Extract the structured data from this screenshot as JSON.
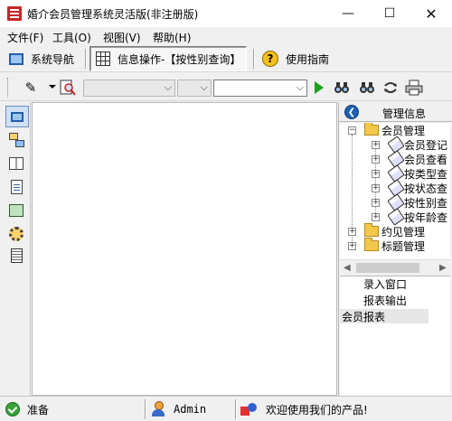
{
  "window": {
    "title": "婚介会员管理系统灵活版(非注册版)",
    "minimize_glyph": "—",
    "maximize_glyph": "☐",
    "close_glyph": "✕"
  },
  "menu": {
    "file": "文件(F)",
    "tools": "工具(O)",
    "view": "视图(V)",
    "help": "帮助(H)"
  },
  "nav": {
    "system_nav": "系统导航",
    "info_ops": "信息操作-【按性别查询】",
    "user_guide": "使用指南"
  },
  "toolbar": {
    "pencil_icon": "✎",
    "search_icons": [
      "binoculars-icon",
      "binoculars-icon",
      "refresh-icon",
      "printer-icon"
    ]
  },
  "right_panel": {
    "header_title": "管理信息",
    "collapse_glyph": "❮",
    "tree": {
      "member_mgmt": "会员管理",
      "children": [
        "会员登记",
        "会员查看",
        "按类型查",
        "按状态查",
        "按性别查",
        "按年龄查"
      ],
      "date_mgmt": "约见管理",
      "title_mgmt": "标题管理"
    },
    "windows": {
      "entry_window": "录入窗口",
      "report_output": "报表输出",
      "member_report": "会员报表"
    }
  },
  "status": {
    "ready": "准备",
    "user": "Admin",
    "welcome": "欢迎使用我们的产品!"
  }
}
